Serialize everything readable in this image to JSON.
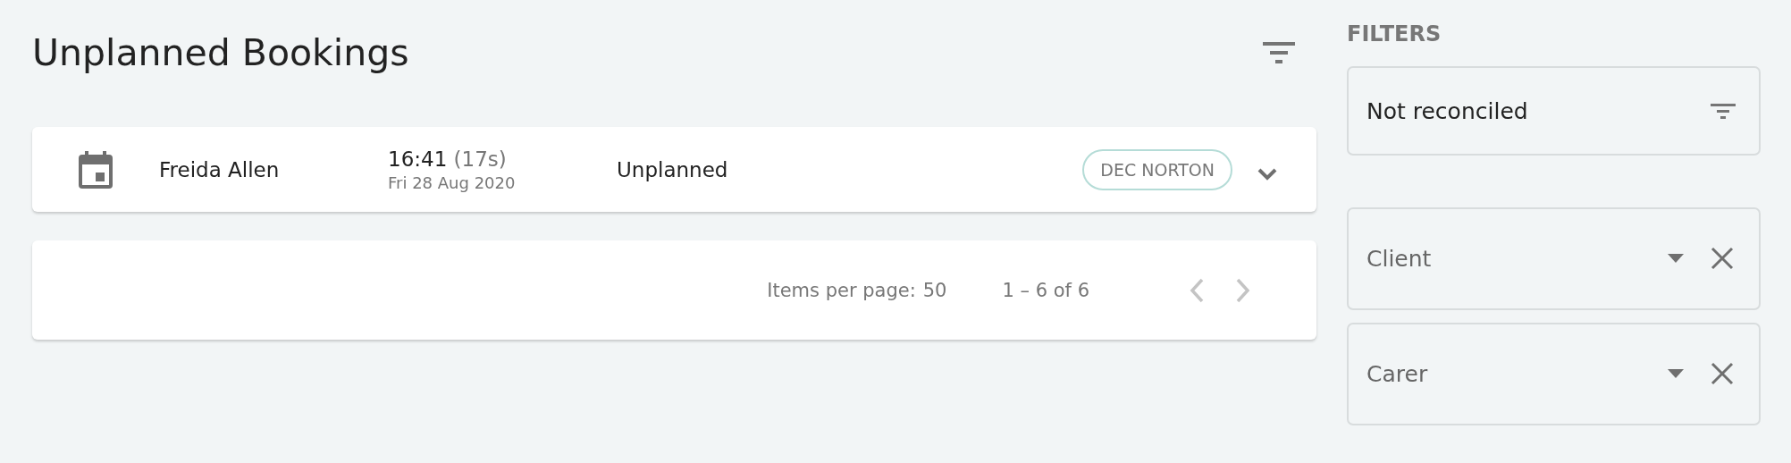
{
  "page": {
    "title": "Unplanned Bookings"
  },
  "bookings": [
    {
      "client": "Freida Allen",
      "time": "16:41",
      "duration": "(17s)",
      "date": "Fri 28 Aug 2020",
      "status": "Unplanned",
      "carer": "DEC NORTON",
      "expanded": false
    }
  ],
  "pagination": {
    "items_per_page_label": "Items per page:",
    "items_per_page": "50",
    "range": "1 – 6 of 6",
    "previous_disabled": true,
    "next_disabled": true
  },
  "filters": {
    "heading": "FILTERS",
    "reconciliation": {
      "value": "Not reconciled"
    },
    "fields": [
      {
        "placeholder": "Client"
      },
      {
        "placeholder": "Carer"
      }
    ]
  }
}
